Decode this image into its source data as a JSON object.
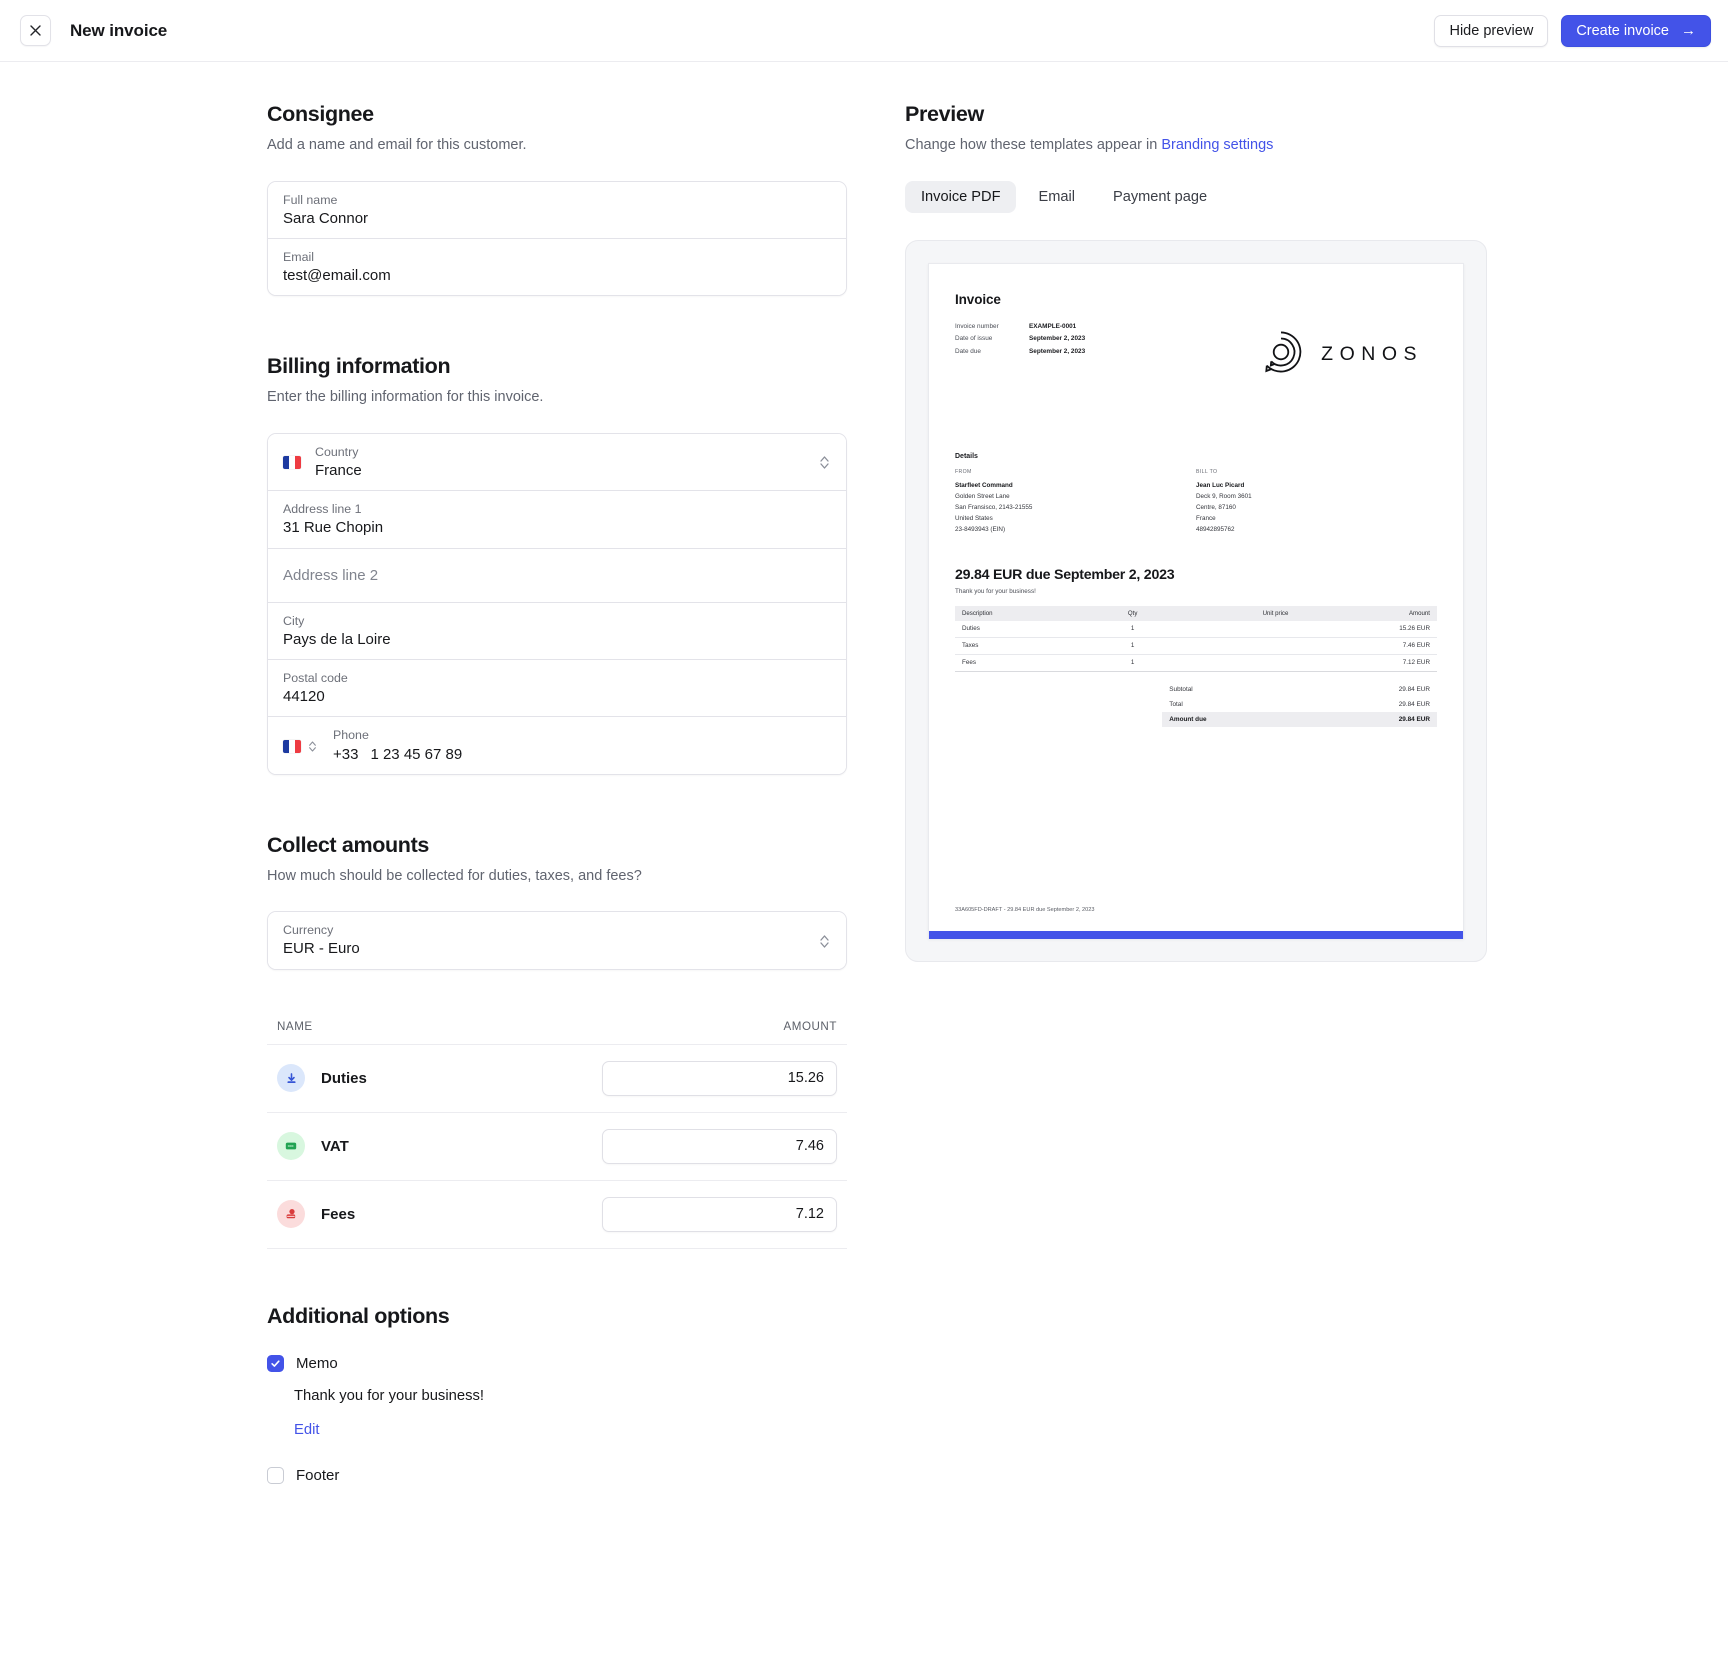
{
  "topbar": {
    "close_icon": "close-icon",
    "title": "New invoice",
    "hide_preview_label": "Hide preview",
    "create_invoice_label": "Create invoice",
    "create_invoice_arrow": "→"
  },
  "consignee": {
    "title": "Consignee",
    "subtitle": "Add a name and email for this customer.",
    "fields": [
      {
        "label": "Full name",
        "value": "Sara Connor"
      },
      {
        "label": "Email",
        "value": "test@email.com"
      }
    ]
  },
  "billing": {
    "title": "Billing information",
    "subtitle": "Enter the billing information for this invoice.",
    "country": {
      "label": "Country",
      "value": "France",
      "flag": "fr-flag-icon"
    },
    "address1": {
      "label": "Address line 1",
      "value": "31 Rue Chopin"
    },
    "address2": {
      "label": "",
      "placeholder": "Address line 2",
      "value": ""
    },
    "city": {
      "label": "City",
      "value": "Pays de la Loire"
    },
    "postal": {
      "label": "Postal code",
      "value": "44120"
    },
    "phone": {
      "label": "Phone",
      "country_code": "+33",
      "value": "1 23 45 67 89",
      "flag": "fr-flag-icon"
    }
  },
  "collect": {
    "title": "Collect amounts",
    "subtitle": "How much should be collected for duties, taxes, and fees?",
    "currency": {
      "label": "Currency",
      "value": "EUR - Euro"
    },
    "table_headers": {
      "name": "NAME",
      "amount": "AMOUNT"
    },
    "rows": [
      {
        "name": "Duties",
        "amount": "15.26",
        "icon": "duties-download-icon",
        "icon_color": "#dbe7fb",
        "glyph_color": "#3555d6"
      },
      {
        "name": "VAT",
        "amount": "7.46",
        "icon": "vat-receipt-icon",
        "icon_color": "#d8f7df",
        "glyph_color": "#22a353"
      },
      {
        "name": "Fees",
        "amount": "7.12",
        "icon": "fees-stack-icon",
        "icon_color": "#fbdcdc",
        "glyph_color": "#d93b3b"
      }
    ]
  },
  "additional": {
    "title": "Additional options",
    "memo": {
      "label": "Memo",
      "checked": true,
      "text": "Thank you for your business!",
      "edit_label": "Edit"
    },
    "footer": {
      "label": "Footer",
      "checked": false
    }
  },
  "preview": {
    "title": "Preview",
    "subtitle_prefix": "Change how these templates appear in ",
    "subtitle_link": "Branding settings",
    "tabs": [
      {
        "label": "Invoice PDF",
        "active": true
      },
      {
        "label": "Email",
        "active": false
      },
      {
        "label": "Payment page",
        "active": false
      }
    ],
    "document": {
      "heading": "Invoice",
      "meta": [
        {
          "key": "Invoice number",
          "value": "EXAMPLE-0001"
        },
        {
          "key": "Date of issue",
          "value": "September 2, 2023"
        },
        {
          "key": "Date due",
          "value": "September 2, 2023"
        }
      ],
      "brand": "ZONOS",
      "details_heading": "Details",
      "from": {
        "label": "FROM",
        "lines": [
          "Starfleet Command",
          "Golden Street Lane",
          "San Fransisco, 2143-21555",
          "United States",
          "23-8493943 (EIN)"
        ]
      },
      "bill_to": {
        "label": "BILL TO",
        "lines": [
          "Jean Luc Picard",
          "Deck 9, Room 3601",
          "Centre, 87160",
          "France",
          "48942895762"
        ]
      },
      "due_headline": "29.84 EUR due September 2, 2023",
      "memo": "Thank you for your business!",
      "table": {
        "headers": [
          "Description",
          "Qty",
          "Unit price",
          "Amount"
        ],
        "rows": [
          {
            "description": "Duties",
            "qty": "1",
            "unit_price": "",
            "amount": "15.26 EUR"
          },
          {
            "description": "Taxes",
            "qty": "1",
            "unit_price": "",
            "amount": "7.46 EUR"
          },
          {
            "description": "Fees",
            "qty": "1",
            "unit_price": "",
            "amount": "7.12 EUR"
          }
        ]
      },
      "summary": [
        {
          "label": "Subtotal",
          "value": "29.84 EUR"
        },
        {
          "label": "Total",
          "value": "29.84 EUR"
        },
        {
          "label": "Amount due",
          "value": "29.84 EUR",
          "emphasis": true
        }
      ],
      "footer_note": "33A605FD-DRAFT - 29.84 EUR due September 2, 2023",
      "accent_color": "#4353e8"
    }
  }
}
